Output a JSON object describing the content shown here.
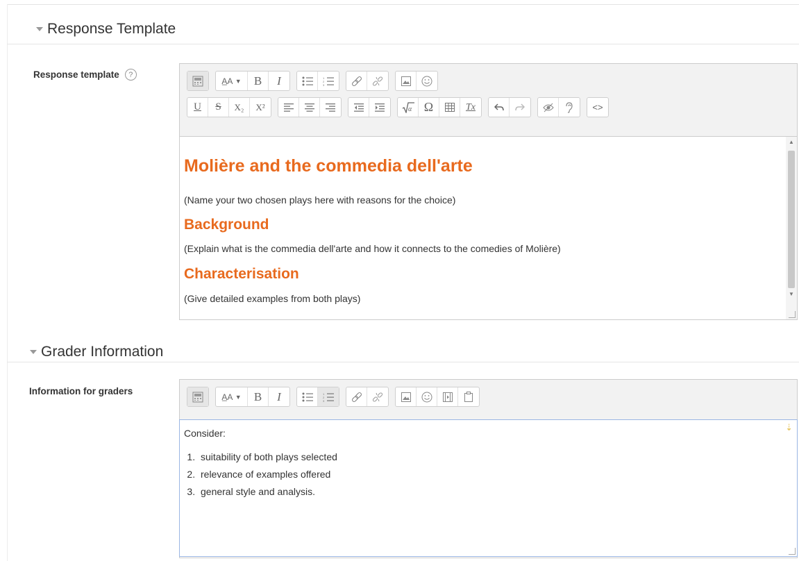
{
  "sections": {
    "response": {
      "title": "Response Template",
      "label": "Response template"
    },
    "grader": {
      "title": "Grader Information",
      "label": "Information for graders"
    }
  },
  "icons": {
    "collapse": "triangle-down",
    "help": "question-circle"
  },
  "response_editor": {
    "heading": "Molière and the commedia dell'arte",
    "intro": "(Name your two chosen  plays here with reasons for the choice)",
    "subheading1": "Background",
    "para1": "(Explain what is the commedia dell'arte and how it connects to the comedies of Molière)",
    "subheading2": "Characterisation",
    "para2": "(Give detailed examples from both plays)"
  },
  "grader_editor": {
    "intro": "Consider:",
    "items": [
      "suitability of both plays selected",
      "relevance of examples offered",
      "general style and analysis."
    ]
  },
  "toolbar": {
    "bold": "B",
    "italic": "I",
    "underline": "U",
    "strike": "S",
    "subscript": "X₂",
    "superscript": "X²",
    "omega": "Ω",
    "clear": "Tx",
    "html": "<>",
    "font_style": "A̲A"
  },
  "colors": {
    "heading_orange": "#e86a1e",
    "toolbar_bg": "#f2f2f2",
    "focus_border": "#9ab6e3"
  }
}
